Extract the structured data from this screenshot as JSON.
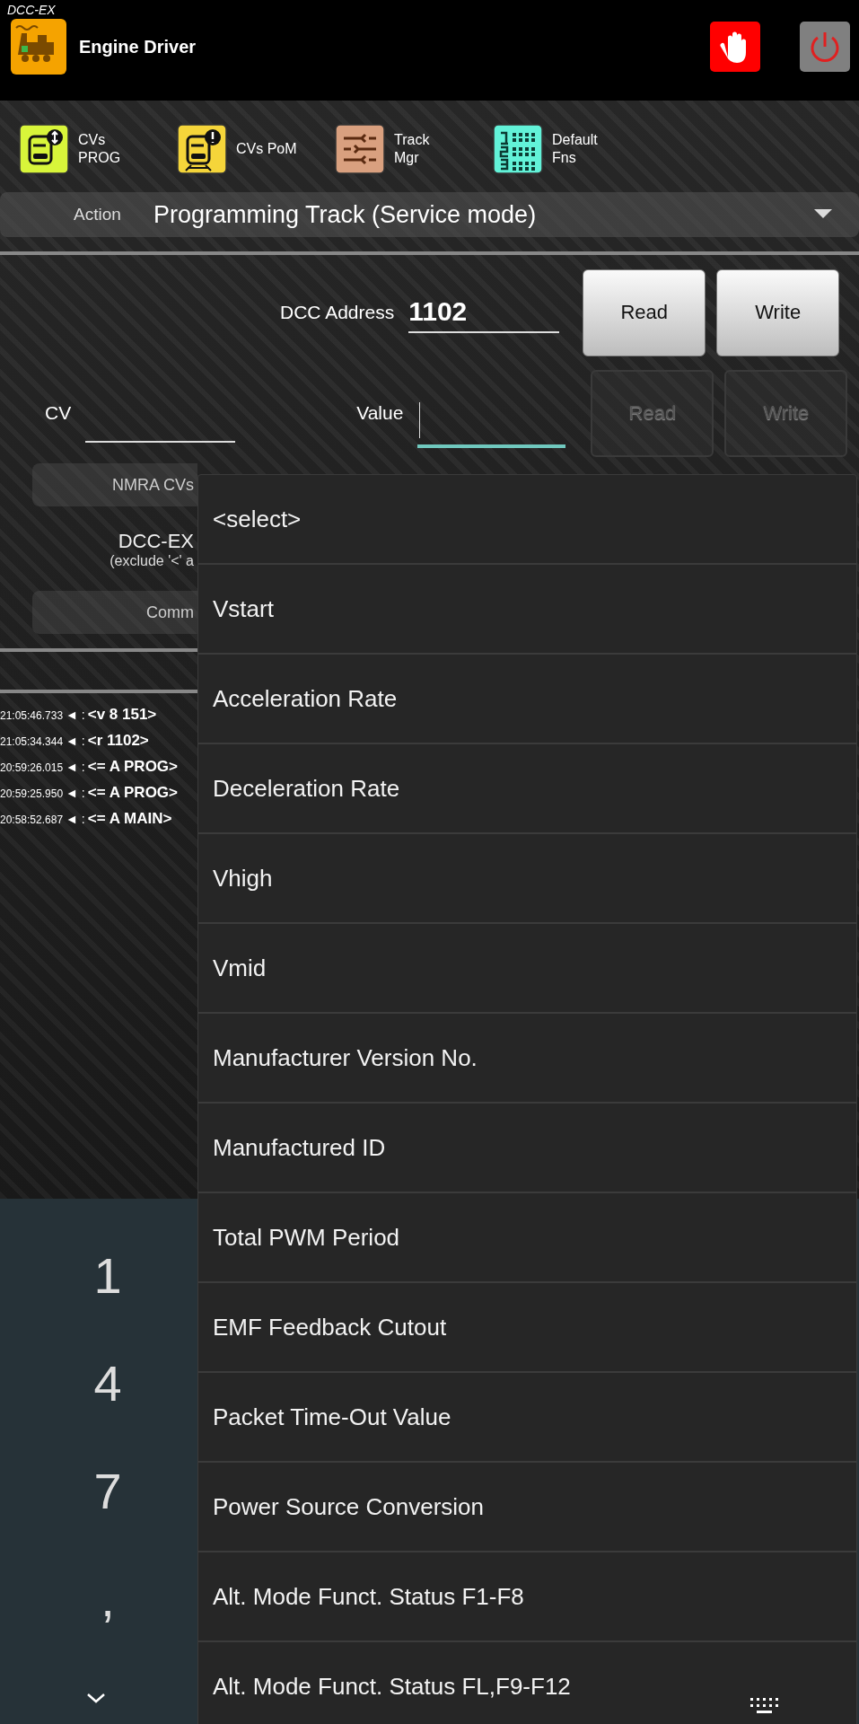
{
  "status_bar": {
    "title": "DCC-EX"
  },
  "header": {
    "title": "Engine Driver"
  },
  "toolbar": [
    {
      "kind": "prog",
      "label": "CVs PROG"
    },
    {
      "kind": "pom",
      "label": "CVs PoM"
    },
    {
      "kind": "track",
      "label": "Track Mgr"
    },
    {
      "kind": "fns",
      "label": "Default Fns"
    }
  ],
  "action": {
    "label": "Action",
    "value": "Programming Track (Service mode)"
  },
  "address": {
    "label": "DCC Address",
    "value": "1102",
    "buttons": [
      {
        "label": "Read",
        "disabled": false
      },
      {
        "label": "Write",
        "disabled": false
      }
    ]
  },
  "cv": {
    "label": "CV",
    "value_label": "Value",
    "value_focused": true,
    "buttons": [
      {
        "label": "Read",
        "disabled": true
      },
      {
        "label": "Write",
        "disabled": true
      }
    ]
  },
  "nmra_button": "NMRA CVs",
  "dccex": {
    "title": "DCC-EX",
    "hint": "(exclude '<' a"
  },
  "command_button": "Comm",
  "log": [
    {
      "time": "21:05:46.733",
      "marker": "◄ :",
      "message": "<v 8 151>"
    },
    {
      "time": "21:05:34.344",
      "marker": "◄ :",
      "message": "<r 1102>"
    },
    {
      "time": "20:59:26.015",
      "marker": "◄ :",
      "message": "<= A PROG>"
    },
    {
      "time": "20:59:25.950",
      "marker": "◄ :",
      "message": "<= A PROG>"
    },
    {
      "time": "20:58:52.687",
      "marker": "◄ :",
      "message": "<= A MAIN>"
    }
  ],
  "keyboard": {
    "keys": [
      "1",
      "4",
      "7",
      ","
    ]
  },
  "dropdown": {
    "items": [
      {
        "label": "<select>",
        "selected": false
      },
      {
        "label": "Vstart",
        "selected": false
      },
      {
        "label": "Acceleration Rate",
        "selected": false
      },
      {
        "label": "Deceleration Rate",
        "selected": false
      },
      {
        "label": "Vhigh",
        "selected": false
      },
      {
        "label": "Vmid",
        "selected": false
      },
      {
        "label": "Manufacturer Version No.",
        "selected": false
      },
      {
        "label": "Manufactured ID",
        "selected": false
      },
      {
        "label": "Total PWM Period",
        "selected": false
      },
      {
        "label": "EMF Feedback Cutout",
        "selected": false
      },
      {
        "label": "Packet Time-Out Value",
        "selected": false
      },
      {
        "label": "Power Source Conversion",
        "selected": false
      },
      {
        "label": "Alt. Mode Funct. Status F1-F8",
        "selected": false
      },
      {
        "label": "Alt. Mode Funct. Status FL,F9-F12",
        "selected": false
      }
    ]
  }
}
